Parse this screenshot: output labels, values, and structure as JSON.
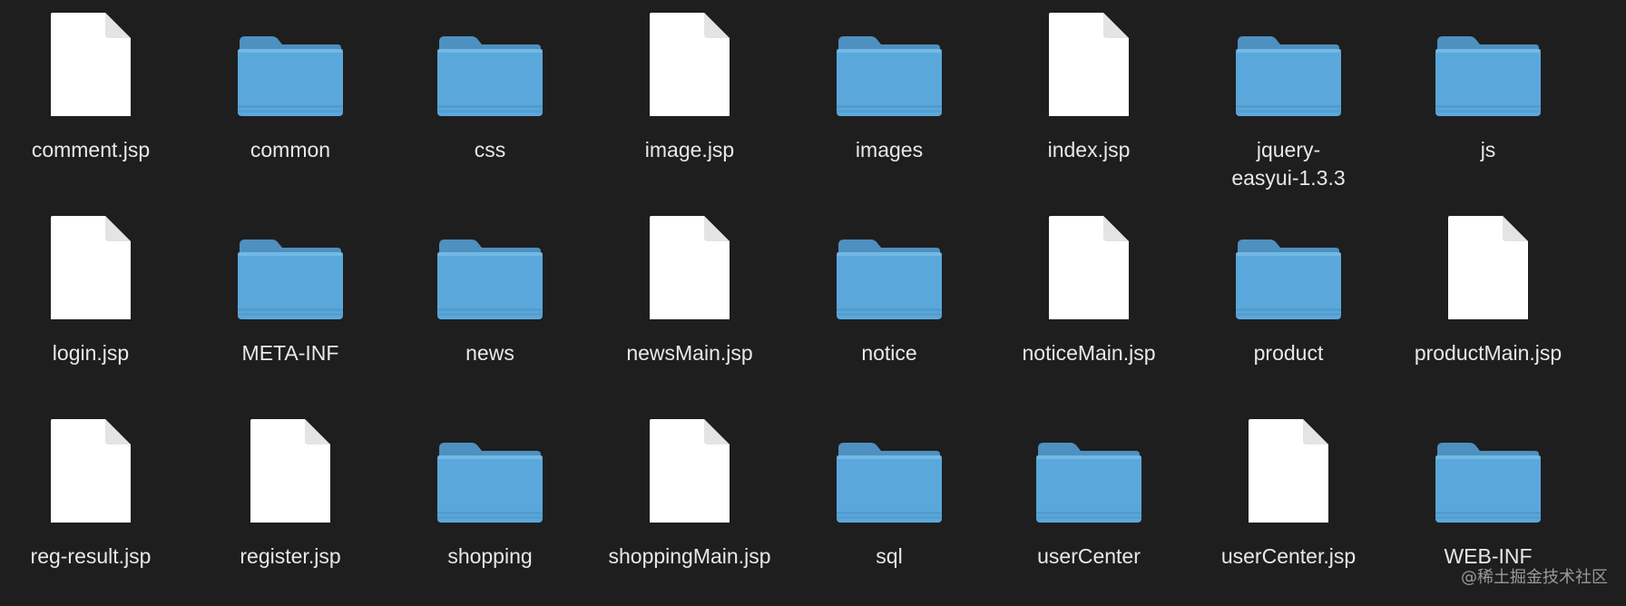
{
  "window": {
    "background": "#1e1e1e"
  },
  "colors": {
    "folder_body": "#5aa8db",
    "folder_tab": "#4e90c0",
    "file_page": "#ffffff",
    "file_fold": "#e4e4e4",
    "label": "#e8e8e8"
  },
  "items": [
    {
      "name": "comment.jsp",
      "kind": "file",
      "icon": "document-icon"
    },
    {
      "name": "common",
      "kind": "folder",
      "icon": "folder-icon"
    },
    {
      "name": "css",
      "kind": "folder",
      "icon": "folder-icon"
    },
    {
      "name": "image.jsp",
      "kind": "file",
      "icon": "document-icon"
    },
    {
      "name": "images",
      "kind": "folder",
      "icon": "folder-icon"
    },
    {
      "name": "index.jsp",
      "kind": "file",
      "icon": "document-icon"
    },
    {
      "name": "jquery-\neasyui-1.3.3",
      "kind": "folder",
      "icon": "folder-icon"
    },
    {
      "name": "js",
      "kind": "folder",
      "icon": "folder-icon"
    },
    {
      "name": "login.jsp",
      "kind": "file",
      "icon": "document-icon"
    },
    {
      "name": "META-INF",
      "kind": "folder",
      "icon": "folder-icon"
    },
    {
      "name": "news",
      "kind": "folder",
      "icon": "folder-icon"
    },
    {
      "name": "newsMain.jsp",
      "kind": "file",
      "icon": "document-icon"
    },
    {
      "name": "notice",
      "kind": "folder",
      "icon": "folder-icon"
    },
    {
      "name": "noticeMain.jsp",
      "kind": "file",
      "icon": "document-icon"
    },
    {
      "name": "product",
      "kind": "folder",
      "icon": "folder-icon"
    },
    {
      "name": "productMain.jsp",
      "kind": "file",
      "icon": "document-icon"
    },
    {
      "name": "reg-result.jsp",
      "kind": "file",
      "icon": "document-icon"
    },
    {
      "name": "register.jsp",
      "kind": "file",
      "icon": "document-icon"
    },
    {
      "name": "shopping",
      "kind": "folder",
      "icon": "folder-icon"
    },
    {
      "name": "shoppingMain.jsp",
      "kind": "file",
      "icon": "document-icon"
    },
    {
      "name": "sql",
      "kind": "folder",
      "icon": "folder-icon"
    },
    {
      "name": "userCenter",
      "kind": "folder",
      "icon": "folder-icon"
    },
    {
      "name": "userCenter.jsp",
      "kind": "file",
      "icon": "document-icon"
    },
    {
      "name": "WEB-INF",
      "kind": "folder",
      "icon": "folder-icon"
    }
  ],
  "watermark": "@稀土掘金技术社区"
}
